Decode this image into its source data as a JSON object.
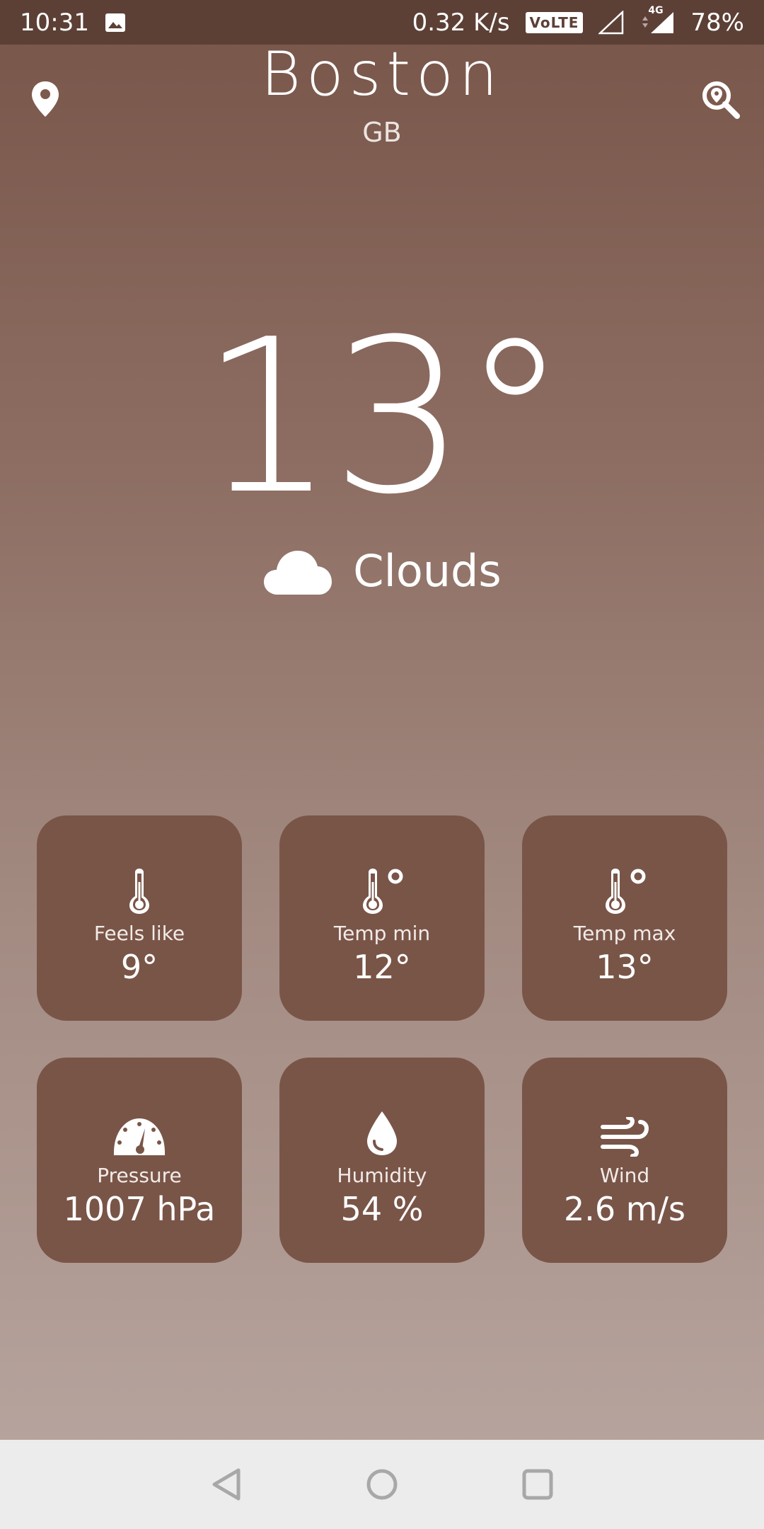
{
  "status_bar": {
    "time": "10:31",
    "net_speed": "0.32 K/s",
    "volte": "VoLTE",
    "network_type": "4G",
    "battery": "78%"
  },
  "header": {
    "city": "Boston",
    "country": "GB"
  },
  "current": {
    "temperature": "13°",
    "condition": "Clouds"
  },
  "cards": [
    {
      "icon": "thermometer-icon",
      "label": "Feels like",
      "value": "9°"
    },
    {
      "icon": "thermometer-degree-icon",
      "label": "Temp min",
      "value": "12°"
    },
    {
      "icon": "thermometer-degree-icon",
      "label": "Temp max",
      "value": "13°"
    },
    {
      "icon": "gauge-icon",
      "label": "Pressure",
      "value": "1007 hPa"
    },
    {
      "icon": "water-drop-icon",
      "label": "Humidity",
      "value": "54 %"
    },
    {
      "icon": "wind-icon",
      "label": "Wind",
      "value": "2.6 m/s"
    }
  ],
  "colors": {
    "card_background": "#795548",
    "status_bar": "#5c4036",
    "nav_bar": "#ececec"
  }
}
